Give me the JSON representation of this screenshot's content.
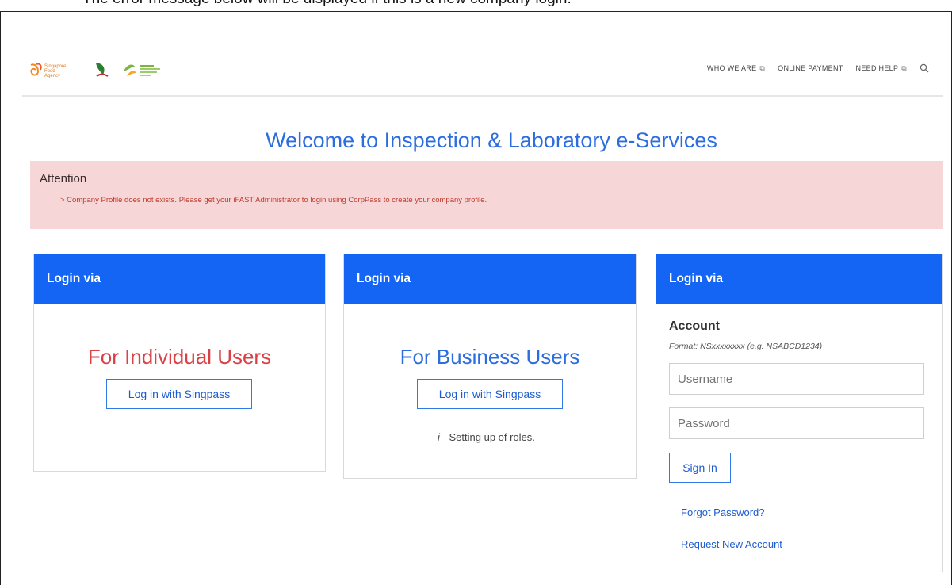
{
  "caption": "The error message below will be displayed if this is a new company login.",
  "header": {
    "logos": [
      {
        "name": "singapore-food-agency-logo",
        "text": "Singapore Food Agency"
      },
      {
        "name": "partner-logo-2",
        "text": ""
      },
      {
        "name": "animal-veterinary-service-logo",
        "text": ""
      }
    ],
    "nav": [
      {
        "label": "WHO WE ARE",
        "external": true
      },
      {
        "label": "ONLINE PAYMENT",
        "external": false
      },
      {
        "label": "NEED HELP",
        "external": true
      }
    ],
    "search_icon": "search-icon"
  },
  "welcome": "Welcome to Inspection & Laboratory e-Services",
  "alert": {
    "title": "Attention",
    "message": "> Company Profile does not exists. Please get your iFAST Administrator to login using CorpPass to create your company profile."
  },
  "cards": {
    "individual": {
      "header": "Login via",
      "title": "For Individual Users",
      "button": "Log in with Singpass"
    },
    "business": {
      "header": "Login via",
      "title": "For Business Users",
      "button": "Log in with Singpass",
      "note_icon": "i",
      "note": "Setting up of roles."
    },
    "account": {
      "header": "Login via",
      "title": "Account",
      "format": "Format: NSxxxxxxxx (e.g. NSABCD1234)",
      "username_placeholder": "Username",
      "password_placeholder": "Password",
      "signin": "Sign In",
      "forgot": "Forgot Password?",
      "request": "Request New Account"
    }
  },
  "colors": {
    "primary": "#1565f5",
    "welcome": "#2b6cdf",
    "individual_title": "#d94147",
    "business_title": "#2b6cdf",
    "alert_bg": "#f7d6d8",
    "alert_text": "#c0392b"
  }
}
